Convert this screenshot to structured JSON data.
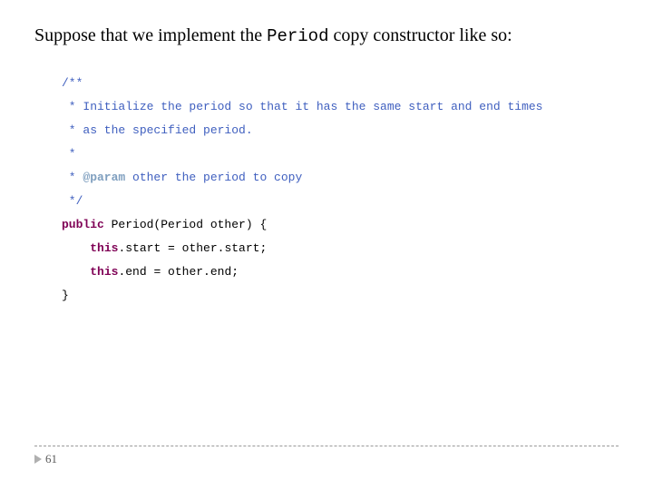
{
  "title": {
    "prefix": "Suppose that we implement the ",
    "mono": "Period",
    "suffix": " copy constructor like so:"
  },
  "code": {
    "l1": "/**",
    "l2": " * Initialize the period so that it has the same start and end times",
    "l3": " * as the specified period.",
    "l4": " * ",
    "l5a": " * ",
    "l5tag": "@param",
    "l5b": " other the period to copy",
    "l6": " */",
    "l7a": "public",
    "l7b": " Period(Period other) {",
    "l8a": "    ",
    "l8b": "this",
    "l8c": ".start = other.start;",
    "l9a": "    ",
    "l9b": "this",
    "l9c": ".end = other.end;",
    "l10": "}"
  },
  "page": "61"
}
